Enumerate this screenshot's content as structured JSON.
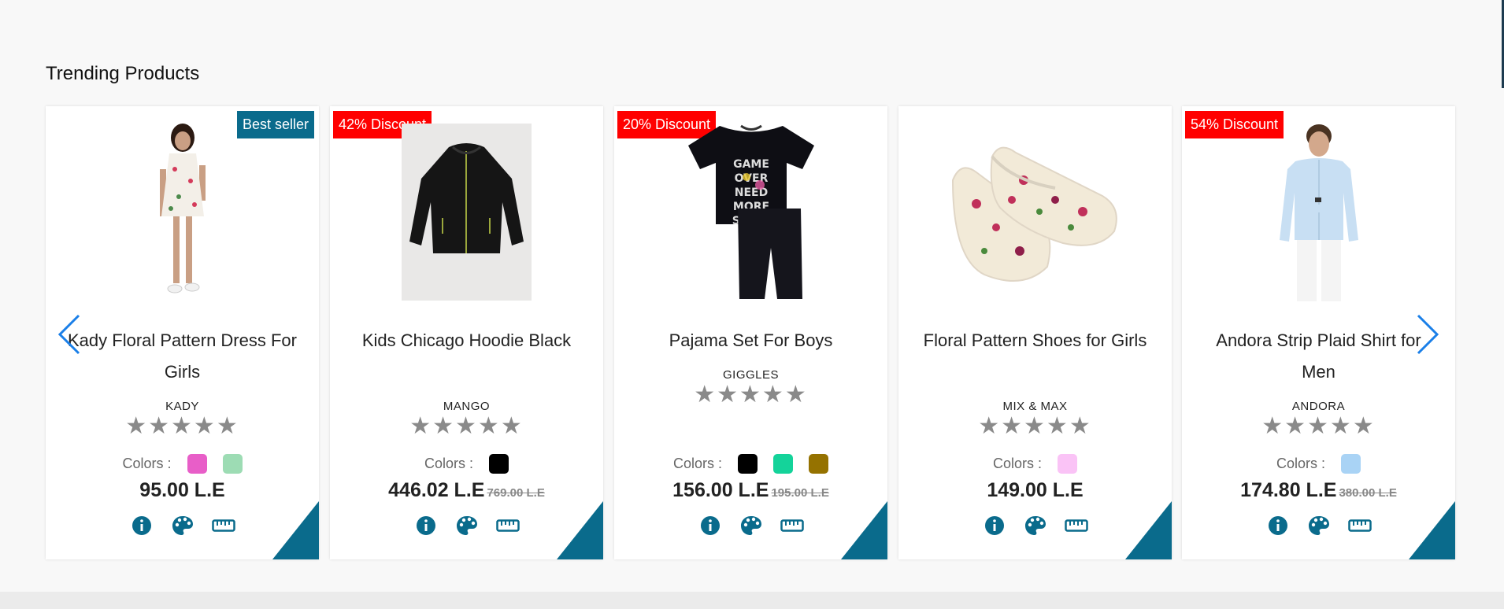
{
  "section": {
    "title": "Trending Products"
  },
  "colors_label": "Colors :",
  "accent_color": "#0a6b8c",
  "discount_color": "#ff0000",
  "products": [
    {
      "badge": "Best seller",
      "name": "Kady Floral Pattern Dress For Girls",
      "brand": "KADY",
      "rating": 0,
      "swatches": [
        "#e85ec8",
        "#9ddcb4"
      ],
      "price": "95.00 L.E",
      "old_price": ""
    },
    {
      "badge": "42% Discount",
      "name": "Kids Chicago Hoodie Black",
      "brand": "MANGO",
      "rating": 0,
      "swatches": [
        "#000000"
      ],
      "price": "446.02 L.E",
      "old_price": "769.00 L.E"
    },
    {
      "badge": "20% Discount",
      "name": "Pajama Set For Boys",
      "brand": "GIGGLES",
      "rating": 0,
      "swatches": [
        "#000000",
        "#14d39a",
        "#957200"
      ],
      "price": "156.00 L.E",
      "old_price": "195.00 L.E"
    },
    {
      "badge": "",
      "name": "Floral Pattern Shoes for Girls",
      "brand": "MIX & MAX",
      "rating": 0,
      "swatches": [
        "#fac3f6"
      ],
      "price": "149.00 L.E",
      "old_price": ""
    },
    {
      "badge": "54% Discount",
      "name": "Andora Strip Plaid Shirt for Men",
      "brand": "ANDORA",
      "rating": 0,
      "swatches": [
        "#a9d3f5"
      ],
      "price": "174.80 L.E",
      "old_price": "380.00 L.E"
    }
  ],
  "icons": [
    "info-icon",
    "palette-icon",
    "ruler-icon",
    "chevron-left-icon",
    "chevron-right-icon"
  ]
}
